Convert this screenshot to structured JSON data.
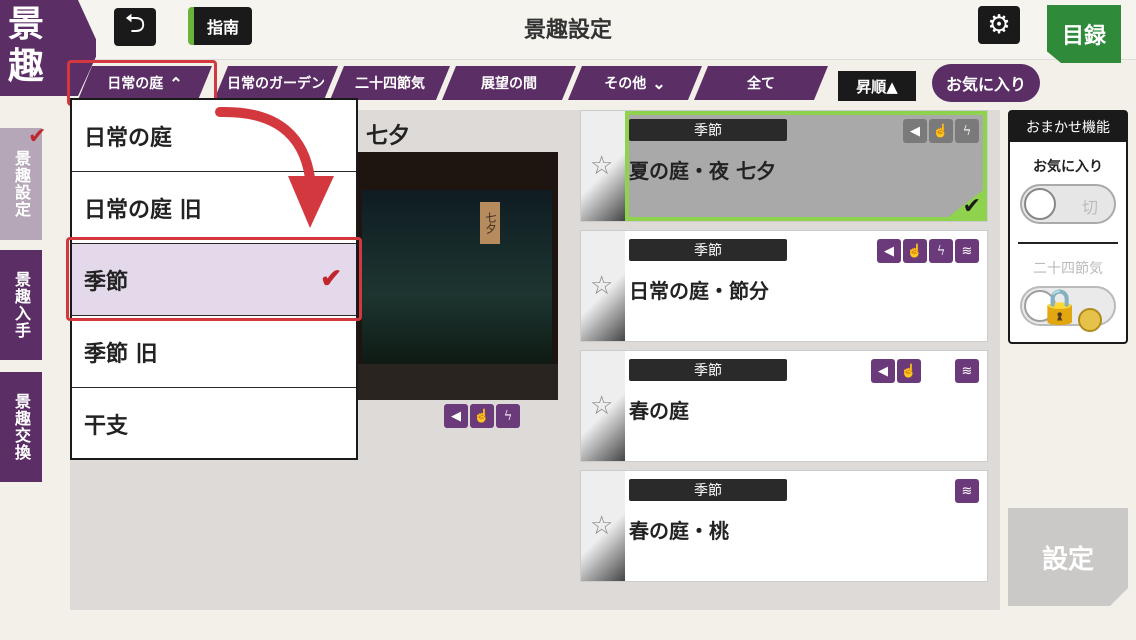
{
  "logo": {
    "chars": [
      "景",
      "趣"
    ]
  },
  "header": {
    "back_icon": "undo-arrow-icon",
    "guide_label": "指南",
    "title": "景趣設定",
    "gear_icon": "gear-icon",
    "catalog_label": "目録"
  },
  "filter_tabs": [
    {
      "label": "日常の庭",
      "chevron": "⌃"
    },
    {
      "label": "日常のガーデン"
    },
    {
      "label": "二十四節気"
    },
    {
      "label": "展望の間"
    },
    {
      "label": "その他",
      "chevron": "⌄"
    },
    {
      "label": "全て"
    }
  ],
  "sort_label": "昇順▲",
  "favorite_filter_label": "お気に入り",
  "side_nav": [
    {
      "label": "景趣設定",
      "active": true
    },
    {
      "label": "景趣入手"
    },
    {
      "label": "景趣交換"
    }
  ],
  "dropdown": {
    "items": [
      "日常の庭",
      "日常の庭 旧",
      "季節",
      "季節 旧",
      "干支"
    ],
    "selected_index": 2
  },
  "preview": {
    "title_partial": "・七夕",
    "tag_text": "七夕"
  },
  "cards": [
    {
      "category": "季節",
      "name": "夏の庭・夜 七夕",
      "icons": [
        "sound-icon",
        "touch-icon",
        "lightning-icon"
      ],
      "selected": true
    },
    {
      "category": "季節",
      "name": "日常の庭・節分",
      "icons": [
        "sound-icon",
        "touch-icon",
        "lightning-icon",
        "waves-icon"
      ]
    },
    {
      "category": "季節",
      "name": "春の庭",
      "icons": [
        "sound-icon",
        "touch-icon",
        "waves-icon"
      ]
    },
    {
      "category": "季節",
      "name": "春の庭・桃",
      "icons": [
        "waves-icon"
      ]
    }
  ],
  "omakase": {
    "title": "おまかせ機能",
    "favorite_label": "お気に入り",
    "toggle_off_label": "切",
    "sekki_label": "二十四節気"
  },
  "settei_label": "設定",
  "colors": {
    "purple": "#5b2e66",
    "green": "#2f8a3a",
    "accent_red": "#d3383f",
    "highlight_green": "#8ed24e"
  }
}
